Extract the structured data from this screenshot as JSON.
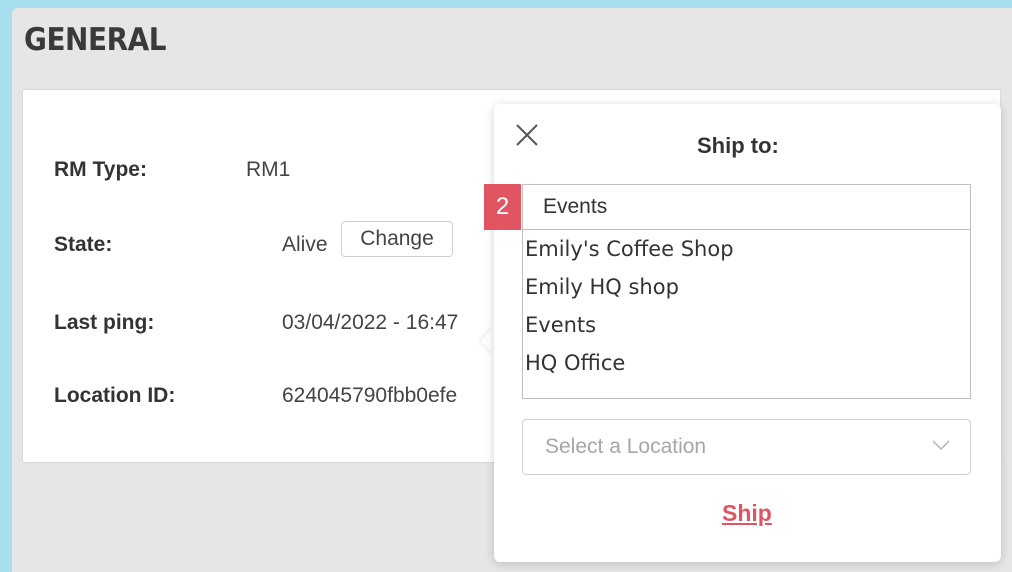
{
  "section": {
    "title": "GENERAL"
  },
  "fields": [
    {
      "label": "RM Type:",
      "value": "RM1"
    },
    {
      "label": "State:",
      "value": "Alive"
    },
    {
      "label": "Last ping:",
      "value": "03/04/2022 - 16:47"
    },
    {
      "label": "Location ID:",
      "value": "624045790fbb0efe"
    }
  ],
  "state_change_label": "Change",
  "popover": {
    "close_icon": "close-icon",
    "title": "Ship to:",
    "step_badge": "2",
    "input_value": "Events",
    "options": [
      "Emily's Coffee Shop",
      "Emily HQ shop",
      "Events",
      "HQ Office"
    ],
    "location_select": {
      "placeholder": "Select a Location",
      "icon": "chevron-down-icon"
    },
    "ship_label": "Ship"
  },
  "colors": {
    "background": "#a8dff0",
    "panel": "#e6e6e6",
    "accent": "#e05561"
  }
}
